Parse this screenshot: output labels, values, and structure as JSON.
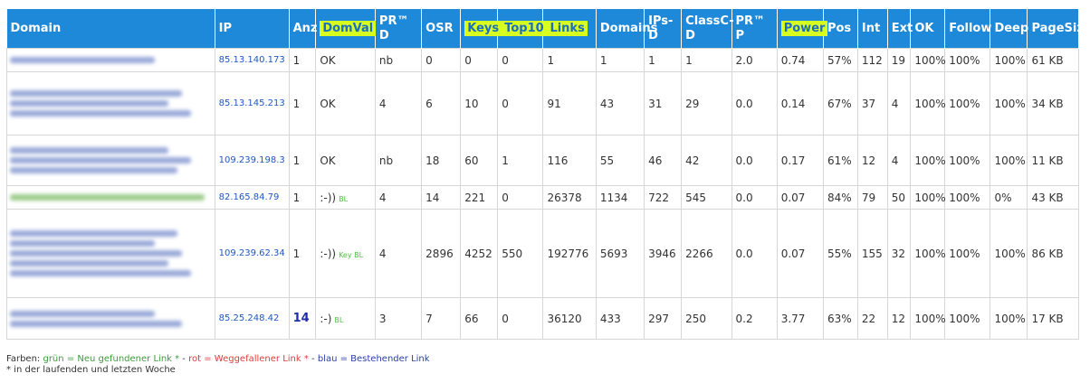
{
  "headers": [
    {
      "label": "Domain",
      "hl": false
    },
    {
      "label": "IP",
      "hl": false
    },
    {
      "label": "Anz",
      "hl": false
    },
    {
      "label": "DomVal",
      "hl": true
    },
    {
      "label": "PR™ D",
      "hl": false
    },
    {
      "label": "OSR",
      "hl": false
    },
    {
      "label": "Keys",
      "hl": true
    },
    {
      "label": "Top10",
      "hl": true
    },
    {
      "label": "Links",
      "hl": true
    },
    {
      "label": "Domains",
      "hl": false
    },
    {
      "label": "IPs-D",
      "hl": false
    },
    {
      "label": "ClassC-D",
      "hl": false
    },
    {
      "label": "PR™ P",
      "hl": false
    },
    {
      "label": "Power",
      "hl": true
    },
    {
      "label": "Pos",
      "hl": false
    },
    {
      "label": "Int",
      "hl": false
    },
    {
      "label": "Ext",
      "hl": false
    },
    {
      "label": "OK",
      "hl": false
    },
    {
      "label": "Follow",
      "hl": false
    },
    {
      "label": "Deep",
      "hl": false
    },
    {
      "label": "PageSize",
      "hl": false
    }
  ],
  "rows": [
    {
      "domain_lines": 1,
      "ip": "85.13.140.173",
      "anz": "1",
      "domval": "OK",
      "domval_badge": "",
      "pr_d": "nb",
      "osr": "0",
      "keys": "0",
      "top10": "0",
      "links": "1",
      "domains": "1",
      "ips_d": "1",
      "classc_d": "1",
      "pr_p": "2.0",
      "power": "0.74",
      "pos": "57%",
      "int": "112",
      "ext": "19",
      "ok": "100%",
      "follow": "100%",
      "deep": "100%",
      "pagesize": "61 KB"
    },
    {
      "domain_lines": 3,
      "ip": "85.13.145.213",
      "anz": "1",
      "domval": "OK",
      "domval_badge": "",
      "pr_d": "4",
      "osr": "6",
      "keys": "10",
      "top10": "0",
      "links": "91",
      "domains": "43",
      "ips_d": "31",
      "classc_d": "29",
      "pr_p": "0.0",
      "power": "0.14",
      "pos": "67%",
      "int": "37",
      "ext": "4",
      "ok": "100%",
      "follow": "100%",
      "deep": "100%",
      "pagesize": "34 KB"
    },
    {
      "domain_lines": 3,
      "ip": "109.239.198.3",
      "anz": "1",
      "domval": "OK",
      "domval_badge": "",
      "pr_d": "nb",
      "osr": "18",
      "keys": "60",
      "top10": "1",
      "links": "116",
      "domains": "55",
      "ips_d": "46",
      "classc_d": "42",
      "pr_p": "0.0",
      "power": "0.17",
      "pos": "61%",
      "int": "12",
      "ext": "4",
      "ok": "100%",
      "follow": "100%",
      "deep": "100%",
      "pagesize": "11 KB"
    },
    {
      "domain_lines": 1,
      "domain_green": true,
      "ip": "82.165.84.79",
      "anz": "1",
      "domval": ":-))",
      "domval_badge": "BL",
      "pr_d": "4",
      "osr": "14",
      "keys": "221",
      "top10": "0",
      "links": "26378",
      "domains": "1134",
      "ips_d": "722",
      "classc_d": "545",
      "pr_p": "0.0",
      "power": "0.07",
      "pos": "84%",
      "int": "79",
      "ext": "50",
      "ok": "100%",
      "follow": "100%",
      "deep": "0%",
      "pagesize": "43 KB"
    },
    {
      "domain_lines": 5,
      "ip": "109.239.62.34",
      "anz": "1",
      "domval": ":-))",
      "domval_badge": "Key BL",
      "pr_d": "4",
      "osr": "2896",
      "keys": "4252",
      "top10": "550",
      "links": "192776",
      "domains": "5693",
      "ips_d": "3946",
      "classc_d": "2266",
      "pr_p": "0.0",
      "power": "0.07",
      "pos": "55%",
      "int": "155",
      "ext": "32",
      "ok": "100%",
      "follow": "100%",
      "deep": "100%",
      "pagesize": "86 KB"
    },
    {
      "domain_lines": 2,
      "ip": "85.25.248.42",
      "anz": "14",
      "anz_strong": true,
      "domval": ":-)",
      "domval_badge": "BL",
      "pr_d": "3",
      "osr": "7",
      "keys": "66",
      "top10": "0",
      "links": "36120",
      "domains": "433",
      "ips_d": "297",
      "classc_d": "250",
      "pr_p": "0.2",
      "power": "3.77",
      "pos": "63%",
      "int": "22",
      "ext": "12",
      "ok": "100%",
      "follow": "100%",
      "deep": "100%",
      "pagesize": "17 KB"
    }
  ],
  "footer": {
    "prefix": "Farben: ",
    "green": "grün = Neu gefundener Link *",
    "sep1": " - ",
    "red": "rot = Weggefallener Link *",
    "sep2": " - ",
    "blue": "blau = Bestehender Link",
    "note": "* in der laufenden und letzten Woche"
  },
  "colors": {
    "header_bg": "#1e88d9",
    "highlight": "#d7ff1f",
    "link_blue": "#1f57c2",
    "badge_green": "#4cc23d"
  }
}
